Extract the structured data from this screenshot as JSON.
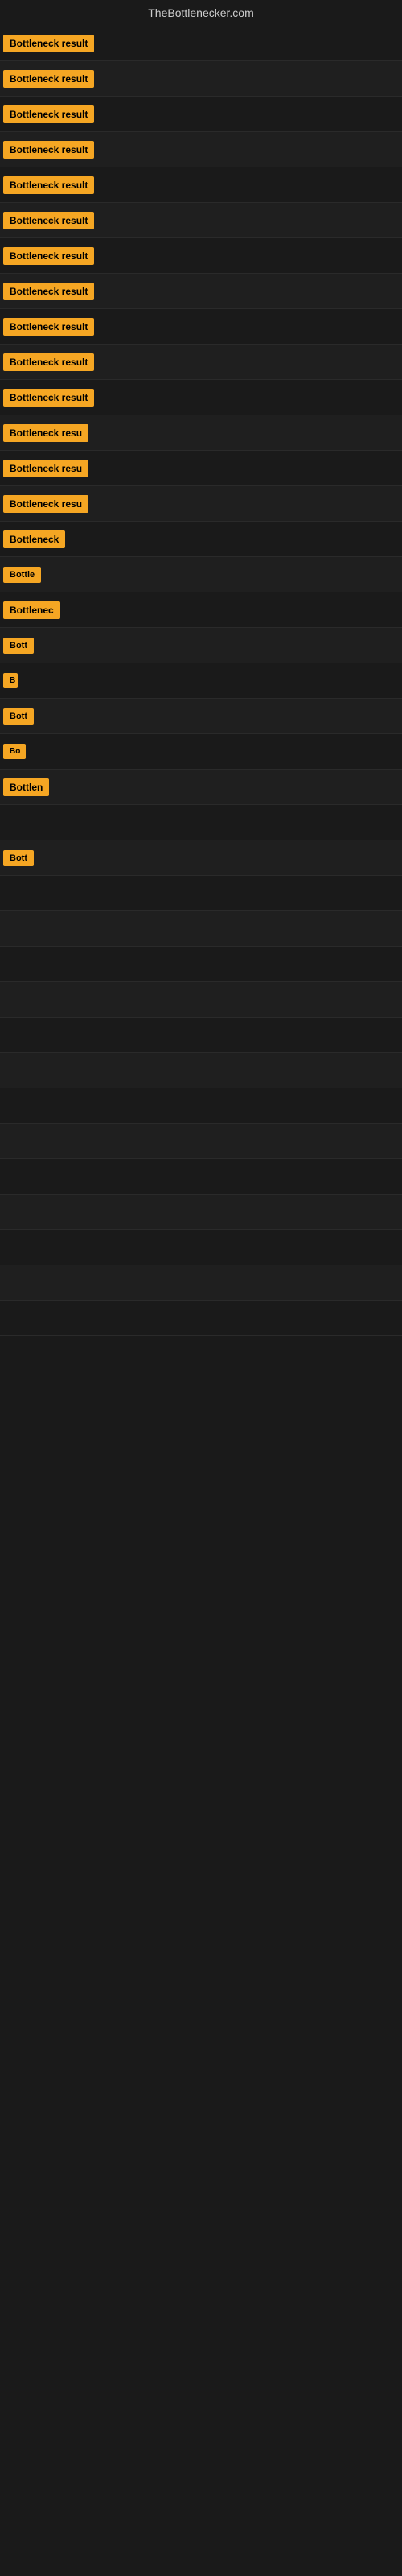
{
  "site": {
    "title": "TheBottlenecker.com"
  },
  "badge_color": "#f5a623",
  "rows": [
    {
      "id": 1,
      "label": "Bottleneck result",
      "width": 155
    },
    {
      "id": 2,
      "label": "Bottleneck result",
      "width": 155
    },
    {
      "id": 3,
      "label": "Bottleneck result",
      "width": 155
    },
    {
      "id": 4,
      "label": "Bottleneck result",
      "width": 155
    },
    {
      "id": 5,
      "label": "Bottleneck result",
      "width": 155
    },
    {
      "id": 6,
      "label": "Bottleneck result",
      "width": 155
    },
    {
      "id": 7,
      "label": "Bottleneck result",
      "width": 155
    },
    {
      "id": 8,
      "label": "Bottleneck result",
      "width": 155
    },
    {
      "id": 9,
      "label": "Bottleneck result",
      "width": 155
    },
    {
      "id": 10,
      "label": "Bottleneck result",
      "width": 155
    },
    {
      "id": 11,
      "label": "Bottleneck result",
      "width": 155
    },
    {
      "id": 12,
      "label": "Bottleneck resu",
      "width": 130
    },
    {
      "id": 13,
      "label": "Bottleneck resu",
      "width": 130
    },
    {
      "id": 14,
      "label": "Bottleneck resu",
      "width": 120
    },
    {
      "id": 15,
      "label": "Bottleneck",
      "width": 90
    },
    {
      "id": 16,
      "label": "Bottle",
      "width": 58
    },
    {
      "id": 17,
      "label": "Bottlenec",
      "width": 80
    },
    {
      "id": 18,
      "label": "Bott",
      "width": 44
    },
    {
      "id": 19,
      "label": "B",
      "width": 18
    },
    {
      "id": 20,
      "label": "Bott",
      "width": 44
    },
    {
      "id": 21,
      "label": "Bo",
      "width": 28
    },
    {
      "id": 22,
      "label": "Bottlen",
      "width": 68
    },
    {
      "id": 23,
      "label": "",
      "width": 8
    },
    {
      "id": 24,
      "label": "Bott",
      "width": 44
    },
    {
      "id": 25,
      "label": "",
      "width": 0
    },
    {
      "id": 26,
      "label": "",
      "width": 0
    },
    {
      "id": 27,
      "label": "",
      "width": 0
    },
    {
      "id": 28,
      "label": "",
      "width": 0
    },
    {
      "id": 29,
      "label": "",
      "width": 0
    },
    {
      "id": 30,
      "label": "",
      "width": 0
    },
    {
      "id": 31,
      "label": "",
      "width": 0
    },
    {
      "id": 32,
      "label": "",
      "width": 0
    },
    {
      "id": 33,
      "label": "",
      "width": 0
    },
    {
      "id": 34,
      "label": "",
      "width": 0
    },
    {
      "id": 35,
      "label": "",
      "width": 0
    },
    {
      "id": 36,
      "label": "",
      "width": 0
    },
    {
      "id": 37,
      "label": "",
      "width": 0
    }
  ]
}
